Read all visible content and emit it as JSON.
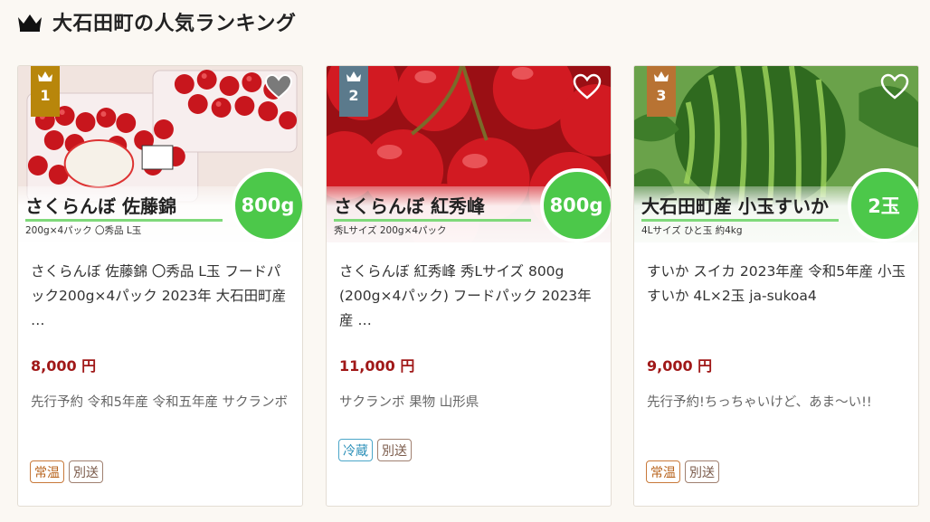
{
  "section": {
    "title": "大石田町の人気ランキング",
    "icon": "crown-icon"
  },
  "products": [
    {
      "rank": "1",
      "photo_name": "さくらんぼ 佐藤錦",
      "photo_sub": "200g×4パック 〇秀品 L玉",
      "weight_badge": "800g",
      "description": "さくらんぼ 佐藤錦 〇秀品 L玉 フードパック200g×4パック 2023年 大石田町産 …",
      "price": "8,000 円",
      "tags": "先行予約 令和5年産 令和五年産 サクランボ",
      "badges": [
        "常温",
        "別送"
      ]
    },
    {
      "rank": "2",
      "photo_name": "さくらんぼ 紅秀峰",
      "photo_sub": "秀Lサイズ 200g×4パック",
      "weight_badge": "800g",
      "description": "さくらんぼ 紅秀峰 秀Lサイズ 800g (200g×4パック) フードパック 2023年産 …",
      "price": "11,000 円",
      "tags": "サクランボ 果物 山形県",
      "badges": [
        "冷蔵",
        "別送"
      ]
    },
    {
      "rank": "3",
      "photo_name": "大石田町産 小玉すいか",
      "photo_sub": "4Lサイズ ひと玉 約4kg",
      "weight_badge": "2玉",
      "description": "すいか スイカ 2023年産 令和5年産 小玉すいか 4L×2玉 ja-sukoa4",
      "price": "9,000 円",
      "tags": "先行予約!ちっちゃいけど、あま〜い!!",
      "badges": [
        "常温",
        "別送"
      ]
    }
  ],
  "colors": {
    "rank1": "#b8860b",
    "rank2": "#5b7a8c",
    "rank3": "#b87333",
    "price": "#a01818",
    "weight_badge": "#4cc84a",
    "badge_jouon": "#c8793a",
    "badge_reizou": "#4ba6c9"
  }
}
